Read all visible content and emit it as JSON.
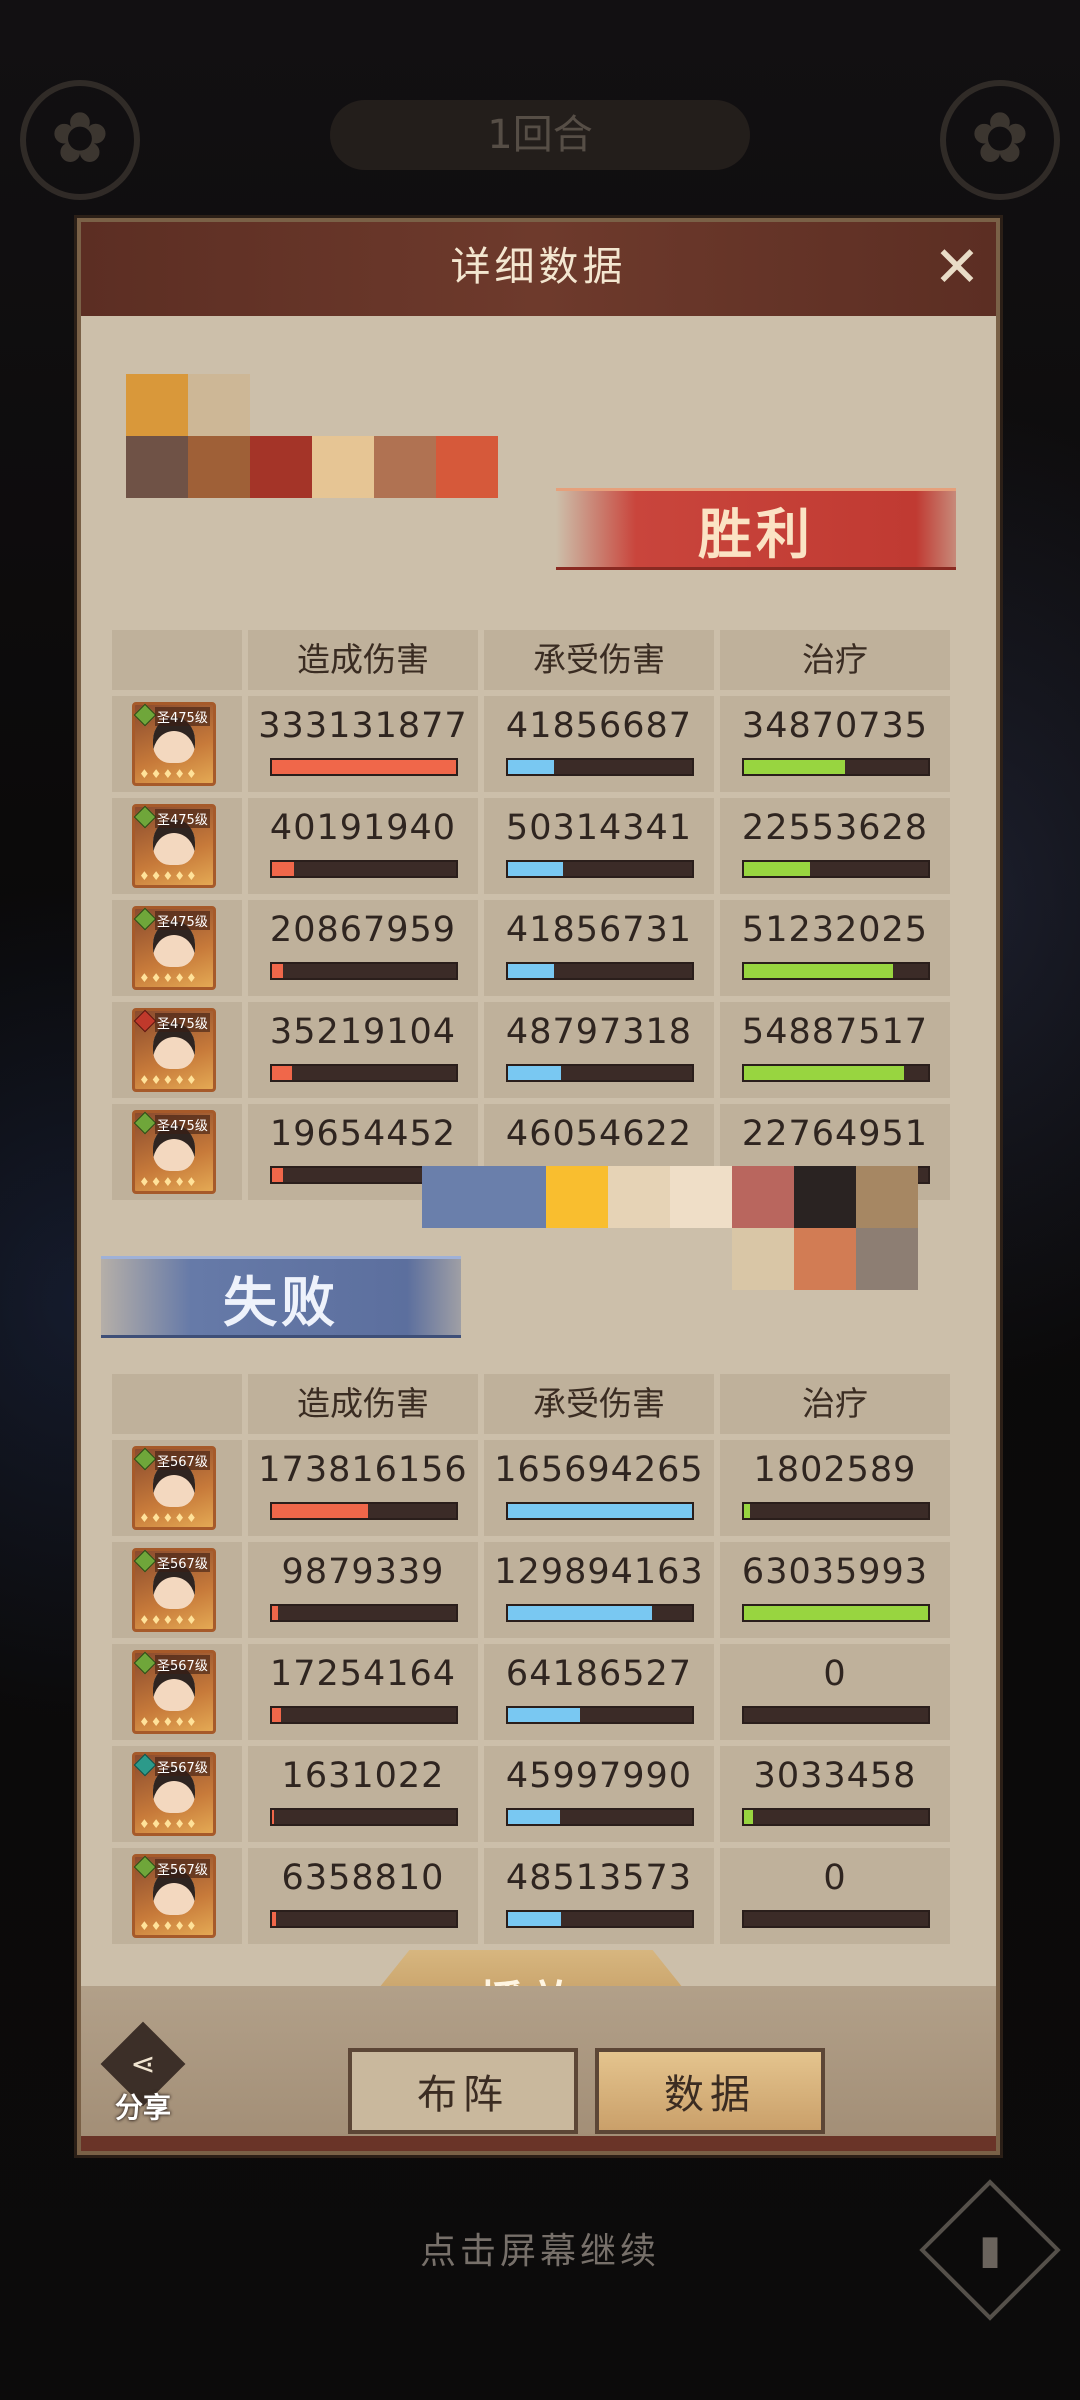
{
  "background": {
    "round_label": "1回合",
    "emblem_left": "✿",
    "emblem_right": "✿"
  },
  "panel": {
    "title": "详细数据",
    "close_icon": "✕"
  },
  "winner": {
    "label": "胜利",
    "swatches_top": [
      "#d9983a",
      "#cdb796"
    ],
    "swatches_bottom": [
      "#6f5246",
      "#9f6037",
      "#a43428",
      "#e6c594",
      "#b07252",
      "#d6593a"
    ]
  },
  "loser": {
    "label": "失败",
    "swatches_top": [
      "#6a7fab",
      "#6a7fab",
      "#f9be2f",
      "#e6d3b6",
      "#efdec7",
      "#b9665e",
      "#2a2322",
      "#a68763"
    ],
    "swatches_bottom": [
      "#d9c6a6",
      "#d27c54",
      "#8d7e73"
    ]
  },
  "headers": {
    "dmg_dealt": "造成伤害",
    "dmg_taken": "承受伤害",
    "healing": "治疗"
  },
  "winner_rows": [
    {
      "level": "圣475级",
      "dealt": "333131877",
      "taken": "41856687",
      "heal": "34870735",
      "dealt_pct": 100,
      "taken_pct": 25,
      "heal_pct": 55
    },
    {
      "level": "圣475级",
      "dealt": "40191940",
      "taken": "50314341",
      "heal": "22553628",
      "dealt_pct": 12,
      "taken_pct": 30,
      "heal_pct": 36
    },
    {
      "level": "圣475级",
      "dealt": "20867959",
      "taken": "41856731",
      "heal": "51232025",
      "dealt_pct": 6,
      "taken_pct": 25,
      "heal_pct": 81
    },
    {
      "level": "圣475级",
      "dealt": "35219104",
      "taken": "48797318",
      "heal": "54887517",
      "dealt_pct": 11,
      "taken_pct": 29,
      "heal_pct": 87
    },
    {
      "level": "圣475级",
      "dealt": "19654452",
      "taken": "46054622",
      "heal": "22764951",
      "dealt_pct": 6,
      "taken_pct": 28,
      "heal_pct": 36
    }
  ],
  "loser_rows": [
    {
      "level": "圣567级",
      "dealt": "173816156",
      "taken": "165694265",
      "heal": "1802589",
      "dealt_pct": 52,
      "taken_pct": 100,
      "heal_pct": 3
    },
    {
      "level": "圣567级",
      "dealt": "9879339",
      "taken": "129894163",
      "heal": "63035993",
      "dealt_pct": 3,
      "taken_pct": 78,
      "heal_pct": 100
    },
    {
      "level": "圣567级",
      "dealt": "17254164",
      "taken": "64186527",
      "heal": "0",
      "dealt_pct": 5,
      "taken_pct": 39,
      "heal_pct": 0
    },
    {
      "level": "圣567级",
      "dealt": "1631022",
      "taken": "45997990",
      "heal": "3033458",
      "dealt_pct": 1,
      "taken_pct": 28,
      "heal_pct": 5
    },
    {
      "level": "圣567级",
      "dealt": "6358810",
      "taken": "48513573",
      "heal": "0",
      "dealt_pct": 2,
      "taken_pct": 29,
      "heal_pct": 0
    }
  ],
  "buttons": {
    "play": "播放",
    "formation": "布阵",
    "data": "数据",
    "share": "分享"
  },
  "continue_text": "点击屏幕继续",
  "colors": {
    "damage_bar": "#f0674a",
    "taken_bar": "#79c8f2",
    "heal_bar": "#98d540"
  }
}
